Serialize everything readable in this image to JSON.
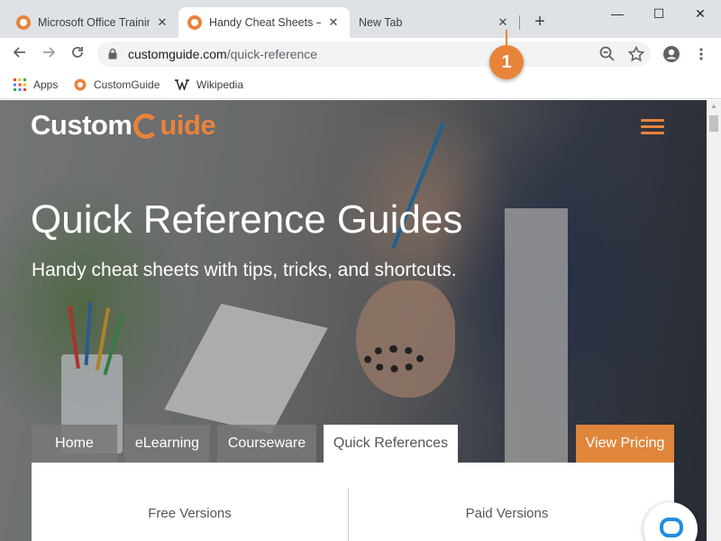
{
  "browser": {
    "tabs": [
      {
        "title": "Microsoft Office Training",
        "active": false
      },
      {
        "title": "Handy Cheat Sheets – N",
        "active": true
      },
      {
        "title": "New Tab",
        "active": false
      }
    ],
    "close_glyph": "✕",
    "new_tab_glyph": "+",
    "window_controls": {
      "minimize": "—",
      "maximize": "☐",
      "close": "✕"
    },
    "address": {
      "host": "customguide.com",
      "path": "/quick-reference"
    },
    "bookmarks": [
      {
        "label": "Apps",
        "icon": "apps-grid-icon"
      },
      {
        "label": "CustomGuide",
        "icon": "customguide-favicon"
      },
      {
        "label": "Wikipedia",
        "icon": "wikipedia-icon"
      }
    ]
  },
  "site": {
    "logo": {
      "part1": "Custom",
      "part2": "uide"
    },
    "hero_title": "Quick Reference Guides",
    "hero_subtitle": "Handy cheat sheets with tips, tricks, and shortcuts.",
    "nav": [
      "Home",
      "eLearning",
      "Courseware",
      "Quick References"
    ],
    "active_nav": "Quick References",
    "pricing_button": "View Pricing",
    "panel": {
      "left_title": "Free Versions",
      "right_title": "Paid Versions"
    }
  },
  "annotation": {
    "step": "1"
  },
  "colors": {
    "brand_orange": "#e8833a",
    "tabstrip": "#dee1e6",
    "chat_blue": "#1f8de0"
  }
}
